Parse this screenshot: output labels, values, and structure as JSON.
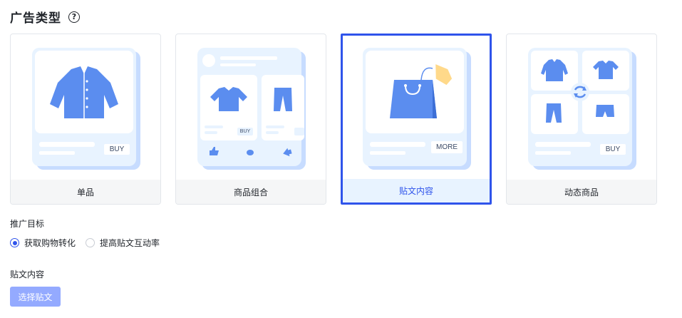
{
  "ad_type": {
    "title": "广告类型",
    "help_icon": "?",
    "cards": [
      {
        "label": "单品",
        "button_text": "BUY",
        "icon": "jacket-illustration",
        "selected": false
      },
      {
        "label": "商品组合",
        "button_text": "BUY",
        "icon": "product-combo-illustration",
        "selected": false
      },
      {
        "label": "贴文内容",
        "button_text": "MORE",
        "icon": "shopping-bag-illustration",
        "selected": true
      },
      {
        "label": "动态商品",
        "button_text": "BUY",
        "icon": "dynamic-products-illustration",
        "selected": false
      }
    ]
  },
  "promotion_goal": {
    "label": "推广目标",
    "options": [
      {
        "text": "获取购物转化",
        "checked": true
      },
      {
        "text": "提高贴文互动率",
        "checked": false
      }
    ]
  },
  "post_content": {
    "label": "贴文内容",
    "button": "选择贴文"
  },
  "colors": {
    "accent": "#2f54eb",
    "illustration_blue": "#5b8def",
    "panel_light": "#e8f3ff",
    "button_disabled": "#94aaff"
  }
}
